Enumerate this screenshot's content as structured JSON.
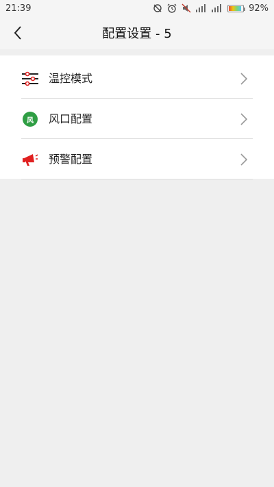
{
  "status_bar": {
    "time": "21:39",
    "battery_percent": "92%",
    "battery_level": 0.92
  },
  "nav": {
    "title": "配置设置 - 5"
  },
  "menu": {
    "items": [
      {
        "label": "温控模式",
        "icon": "sliders-icon"
      },
      {
        "label": "风口配置",
        "icon": "wind-icon",
        "icon_text": "风"
      },
      {
        "label": "预警配置",
        "icon": "megaphone-icon"
      }
    ]
  },
  "colors": {
    "background": "#efefef",
    "panel": "#ffffff",
    "wind_green": "#2f9e44",
    "alert_red": "#e02020"
  }
}
